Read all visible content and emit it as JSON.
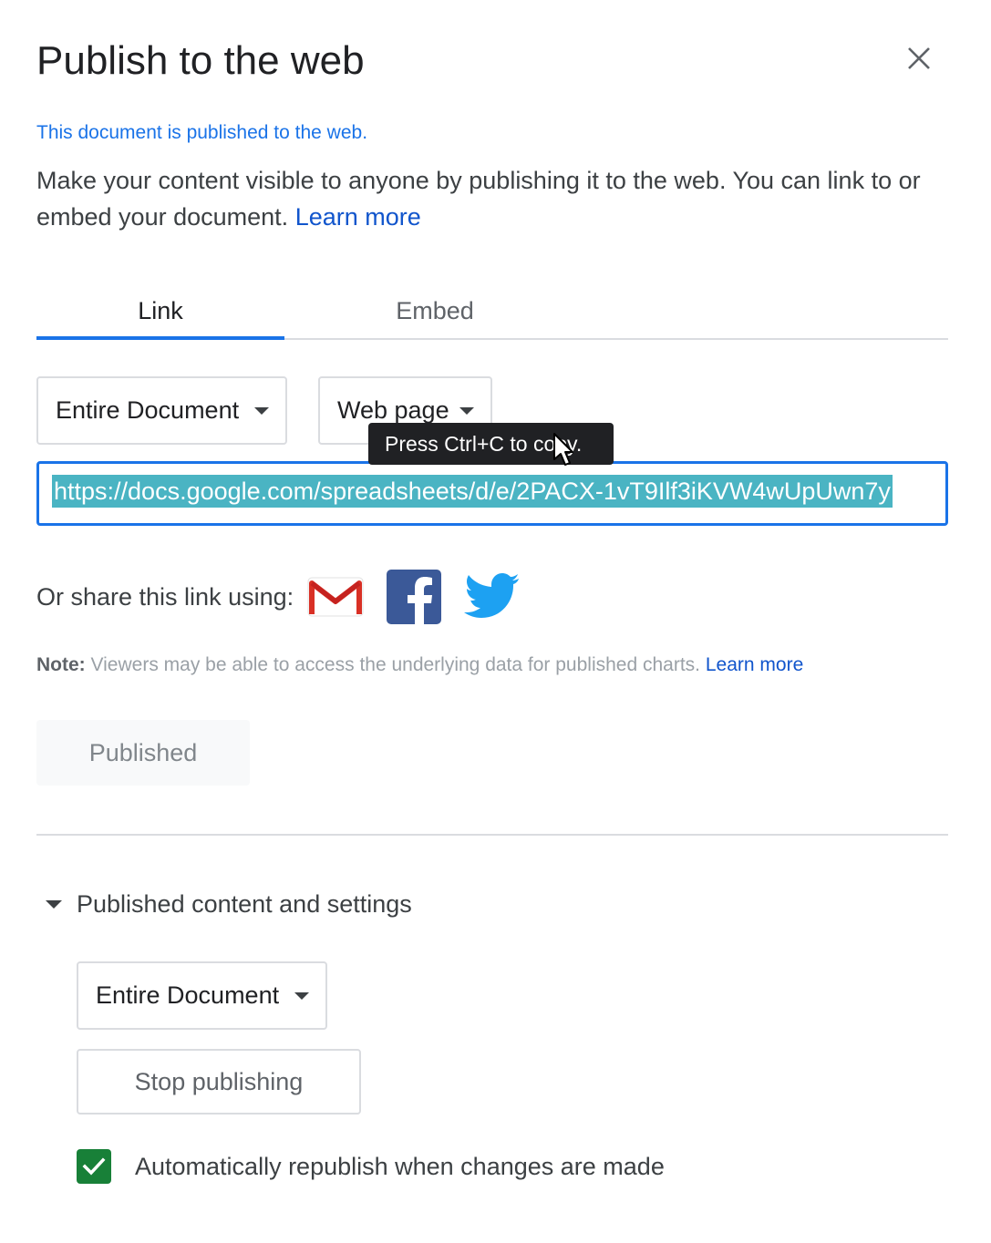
{
  "dialog": {
    "title": "Publish to the web",
    "status": "This document is published to the web.",
    "description": "Make your content visible to anyone by publishing it to the web. You can link to or embed your document.",
    "learn_more": "Learn more"
  },
  "tabs": {
    "link": "Link",
    "embed": "Embed"
  },
  "link_panel": {
    "range_dropdown": "Entire Document",
    "format_dropdown": "Web page",
    "tooltip": "Press Ctrl+C to copy.",
    "url": "https://docs.google.com/spreadsheets/d/e/2PACX-1vT9Ilf3iKVW4wUpUwn7y",
    "share_label": "Or share this link using:",
    "share_icons": [
      "gmail-icon",
      "facebook-icon",
      "twitter-icon"
    ]
  },
  "note": {
    "label": "Note:",
    "text": "Viewers may be able to access the underlying data for published charts.",
    "learn_more": "Learn more"
  },
  "published_button": "Published",
  "settings": {
    "header": "Published content and settings",
    "range_dropdown": "Entire Document",
    "stop_button": "Stop publishing",
    "auto_republish_label": "Automatically republish when changes are made",
    "auto_republish_checked": true
  },
  "colors": {
    "accent": "#1a73e8",
    "link": "#1155cc",
    "selection": "#4ab4c3",
    "checkbox": "#188038"
  }
}
